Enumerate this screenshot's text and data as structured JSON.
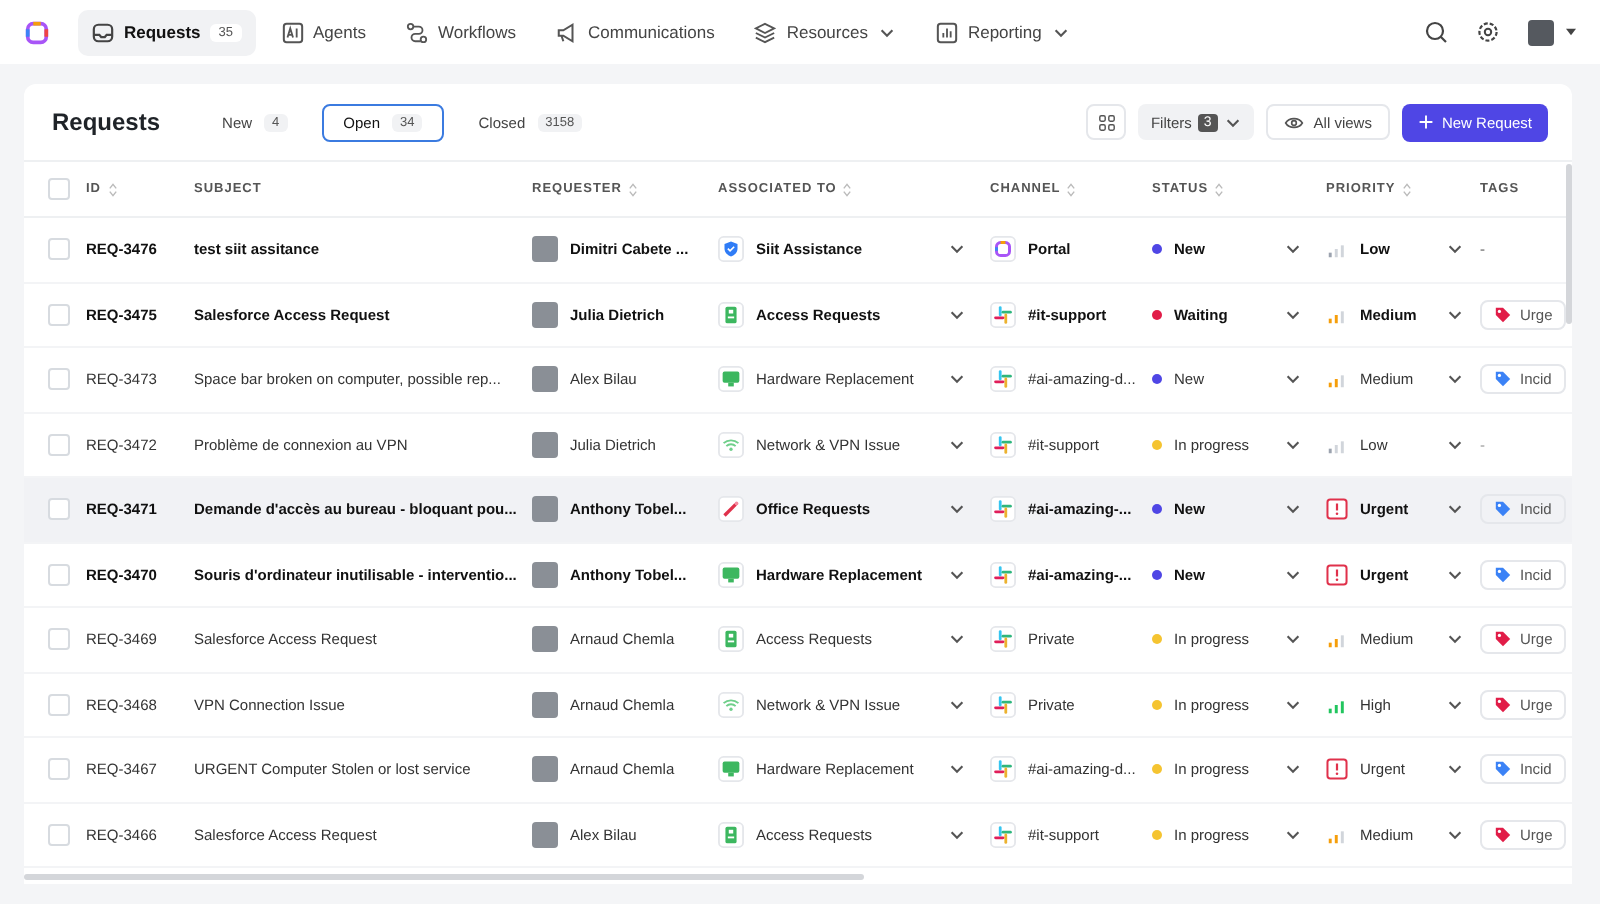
{
  "nav": {
    "items": [
      {
        "kind": "inbox",
        "label": "Requests",
        "count": "35",
        "selected": true
      },
      {
        "kind": "ai",
        "label": "Agents",
        "selected": false
      },
      {
        "kind": "flow",
        "label": "Workflows",
        "selected": false
      },
      {
        "kind": "megaphone",
        "label": "Communications",
        "selected": false
      },
      {
        "kind": "layers",
        "label": "Resources",
        "dropdown": true,
        "selected": false
      },
      {
        "kind": "chart",
        "label": "Reporting",
        "dropdown": true,
        "selected": false
      }
    ]
  },
  "page": {
    "title": "Requests",
    "tabs": [
      {
        "label": "New",
        "count": "4",
        "selected": false
      },
      {
        "label": "Open",
        "count": "34",
        "selected": true
      },
      {
        "label": "Closed",
        "count": "3158",
        "selected": false
      }
    ],
    "filters": {
      "label": "Filters",
      "count": "3"
    },
    "views": "All views",
    "new_button": "New Request"
  },
  "table": {
    "select_all": {
      "checked": false
    },
    "columns": [
      {
        "label": "ID",
        "sortable": true
      },
      {
        "label": "SUBJECT",
        "sortable": false
      },
      {
        "label": "REQUESTER",
        "sortable": true
      },
      {
        "label": "ASSOCIATED TO",
        "sortable": true
      },
      {
        "label": "CHANNEL",
        "sortable": true
      },
      {
        "label": "STATUS",
        "sortable": true
      },
      {
        "label": "PRIORITY",
        "sortable": true
      },
      {
        "label": "TAGS",
        "sortable": false
      }
    ],
    "rows": [
      {
        "id": "REQ-3476",
        "subject": "test siit assitance",
        "requester": "Dimitri Cabete ...",
        "assoc": {
          "kind": "shield",
          "label": "Siit Assistance"
        },
        "channel": {
          "kind": "portal",
          "label": "Portal"
        },
        "status": {
          "label": "New",
          "color": "#4f46e5"
        },
        "priority": {
          "kind": "low",
          "label": "Low"
        },
        "tag": {
          "label": "-"
        },
        "unread": true,
        "hovered": false
      },
      {
        "id": "REQ-3475",
        "subject": "Salesforce Access Request",
        "requester": "Julia Dietrich",
        "assoc": {
          "kind": "access",
          "label": "Access Requests"
        },
        "channel": {
          "kind": "slack",
          "label": "#it-support"
        },
        "status": {
          "label": "Waiting",
          "color": "#e11d48"
        },
        "priority": {
          "kind": "medium",
          "label": "Medium"
        },
        "tag": {
          "label": "Urge",
          "color": "#e11d48"
        },
        "unread": true,
        "hovered": false
      },
      {
        "id": "REQ-3473",
        "subject": "Space bar broken on computer, possible rep...",
        "requester": "Alex Bilau",
        "assoc": {
          "kind": "monitor",
          "label": "Hardware Replacement"
        },
        "channel": {
          "kind": "slack",
          "label": "#ai-amazing-d..."
        },
        "status": {
          "label": "New",
          "color": "#4f46e5"
        },
        "priority": {
          "kind": "medium",
          "label": "Medium"
        },
        "tag": {
          "label": "Incid",
          "color": "#3b82f6"
        },
        "unread": false,
        "hovered": false
      },
      {
        "id": "REQ-3472",
        "subject": "Problème de connexion au VPN",
        "requester": "Julia Dietrich",
        "assoc": {
          "kind": "wifi",
          "label": "Network & VPN Issue"
        },
        "channel": {
          "kind": "slack",
          "label": "#it-support"
        },
        "status": {
          "label": "In progress",
          "color": "#f5c431"
        },
        "priority": {
          "kind": "low",
          "label": "Low"
        },
        "tag": {
          "label": "-"
        },
        "unread": false,
        "hovered": false
      },
      {
        "id": "REQ-3471",
        "subject": "Demande d'accès au bureau - bloquant pou...",
        "requester": "Anthony Tobel...",
        "assoc": {
          "kind": "office",
          "label": "Office Requests"
        },
        "channel": {
          "kind": "slack",
          "label": "#ai-amazing-..."
        },
        "status": {
          "label": "New",
          "color": "#4f46e5"
        },
        "priority": {
          "kind": "urgent",
          "label": "Urgent"
        },
        "tag": {
          "label": "Incid",
          "color": "#3b82f6"
        },
        "unread": true,
        "hovered": true
      },
      {
        "id": "REQ-3470",
        "subject": "Souris d'ordinateur inutilisable - interventio...",
        "requester": "Anthony Tobel...",
        "assoc": {
          "kind": "monitor",
          "label": "Hardware Replacement"
        },
        "channel": {
          "kind": "slack",
          "label": "#ai-amazing-..."
        },
        "status": {
          "label": "New",
          "color": "#4f46e5"
        },
        "priority": {
          "kind": "urgent",
          "label": "Urgent"
        },
        "tag": {
          "label": "Incid",
          "color": "#3b82f6"
        },
        "unread": true,
        "hovered": false
      },
      {
        "id": "REQ-3469",
        "subject": "Salesforce Access Request",
        "requester": "Arnaud Chemla",
        "assoc": {
          "kind": "access",
          "label": "Access Requests"
        },
        "channel": {
          "kind": "slack",
          "label": "Private"
        },
        "status": {
          "label": "In progress",
          "color": "#f5c431"
        },
        "priority": {
          "kind": "medium",
          "label": "Medium"
        },
        "tag": {
          "label": "Urge",
          "color": "#e11d48"
        },
        "unread": false,
        "hovered": false
      },
      {
        "id": "REQ-3468",
        "subject": "VPN Connection Issue",
        "requester": "Arnaud Chemla",
        "assoc": {
          "kind": "wifi",
          "label": "Network & VPN Issue"
        },
        "channel": {
          "kind": "slack",
          "label": "Private"
        },
        "status": {
          "label": "In progress",
          "color": "#f5c431"
        },
        "priority": {
          "kind": "high",
          "label": "High"
        },
        "tag": {
          "label": "Urge",
          "color": "#e11d48"
        },
        "unread": false,
        "hovered": false
      },
      {
        "id": "REQ-3467",
        "subject": "URGENT Computer Stolen or lost service",
        "requester": "Arnaud Chemla",
        "assoc": {
          "kind": "monitor",
          "label": "Hardware Replacement"
        },
        "channel": {
          "kind": "slack",
          "label": "#ai-amazing-d..."
        },
        "status": {
          "label": "In progress",
          "color": "#f5c431"
        },
        "priority": {
          "kind": "urgent",
          "label": "Urgent"
        },
        "tag": {
          "label": "Incid",
          "color": "#3b82f6"
        },
        "unread": false,
        "hovered": false
      },
      {
        "id": "REQ-3466",
        "subject": "Salesforce Access Request",
        "requester": "Alex Bilau",
        "assoc": {
          "kind": "access",
          "label": "Access Requests"
        },
        "channel": {
          "kind": "slack",
          "label": "#it-support"
        },
        "status": {
          "label": "In progress",
          "color": "#f5c431"
        },
        "priority": {
          "kind": "medium",
          "label": "Medium"
        },
        "tag": {
          "label": "Urge",
          "color": "#e11d48"
        },
        "unread": false,
        "hovered": false
      }
    ]
  }
}
